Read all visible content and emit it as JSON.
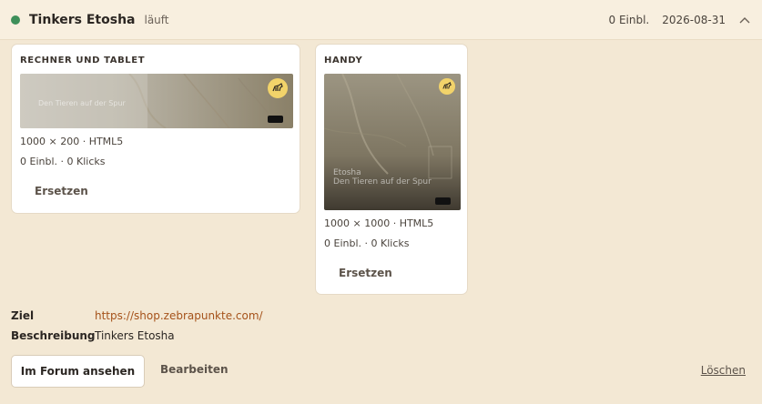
{
  "header": {
    "title": "Tinkers Etosha",
    "status": "läuft",
    "impressions": "0 Einbl.",
    "date": "2026-08-31"
  },
  "cards": [
    {
      "title": "RECHNER UND TABLET",
      "spec": "1000 × 200 · HTML5",
      "stats": "0 Einbl. · 0 Klicks",
      "replace_label": "Ersetzen"
    },
    {
      "title": "HANDY",
      "spec": "1000 × 1000 · HTML5",
      "stats": "0 Einbl. · 0 Klicks",
      "replace_label": "Ersetzen"
    }
  ],
  "preview": {
    "headline_line1": "Etosha",
    "headline_line2": "Den Tieren auf der Spur"
  },
  "details": {
    "target_label": "Ziel",
    "target_url": "https://shop.zebrapunkte.com/",
    "description_label": "Beschreibung",
    "description_value": "Tinkers Etosha"
  },
  "actions": {
    "forum_label": "Im Forum ansehen",
    "edit_label": "Bearbeiten",
    "delete_label": "Löschen"
  },
  "colors": {
    "background": "#f3e8d4",
    "status_running": "#3e8f5a",
    "link": "#a5521a"
  },
  "icons": {
    "status": "status-dot",
    "collapse": "chevron-up-icon",
    "badge": "zebra-logo-icon"
  }
}
